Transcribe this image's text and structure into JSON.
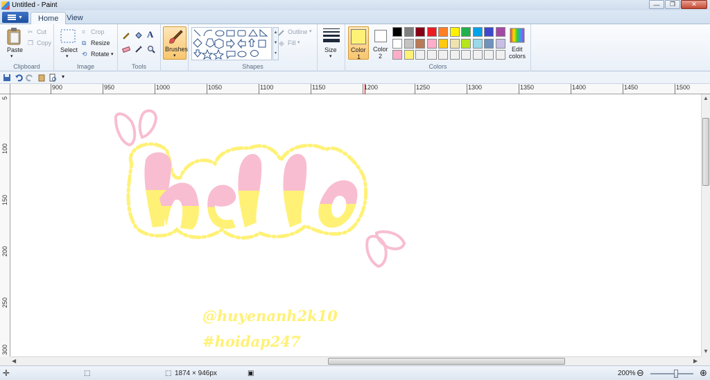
{
  "window": {
    "title": "Untitled - Paint",
    "minimize": "—",
    "maximize": "❐",
    "close": "✕"
  },
  "tabs": [
    {
      "label": "Home"
    },
    {
      "label": "View"
    }
  ],
  "ribbon": {
    "clipboard": {
      "paste": "Paste",
      "cut": "Cut",
      "copy": "Copy",
      "group": "Clipboard"
    },
    "image": {
      "select": "Select",
      "crop": "Crop",
      "resize": "Resize",
      "rotate": "Rotate",
      "group": "Image"
    },
    "tools": {
      "group": "Tools"
    },
    "brushes": {
      "label": "Brushes"
    },
    "shapes": {
      "outline": "Outline",
      "fill": "Fill",
      "group": "Shapes"
    },
    "size": {
      "label": "Size"
    },
    "colors": {
      "color1_label": "Color",
      "color1_num": "1",
      "color2_label": "Color",
      "color2_num": "2",
      "edit_label1": "Edit",
      "edit_label2": "colors",
      "group": "Colors",
      "color1_value": "#fff176",
      "color2_value": "#ffffff",
      "palette_row1": [
        "#000000",
        "#7f7f7f",
        "#880015",
        "#ed1c24",
        "#ff7f27",
        "#fff200",
        "#22b14c",
        "#00a2e8",
        "#3f48cc",
        "#a349a4"
      ],
      "palette_row2": [
        "#ffffff",
        "#c3c3c3",
        "#b97a57",
        "#ffaec9",
        "#ffc90e",
        "#efe4b0",
        "#b5e61d",
        "#99d9ea",
        "#7092be",
        "#c8bfe7"
      ],
      "palette_row3": [
        "#ffaec9",
        "#fff176",
        "#f0f0f0",
        "#f0f0f0",
        "#f0f0f0",
        "#f0f0f0",
        "#f0f0f0",
        "#f0f0f0",
        "#f0f0f0",
        "#f0f0f0"
      ]
    }
  },
  "ruler": {
    "top": [
      "900",
      "950",
      "1000",
      "1050",
      "1100",
      "1150",
      "1200",
      "1250",
      "1300",
      "1350",
      "1400",
      "1450",
      "1500"
    ],
    "left": [
      "5",
      "100",
      "150",
      "200",
      "250",
      "300"
    ]
  },
  "canvas": {
    "word": "hello",
    "pink": "#f8bdd0",
    "yellow": "#fff176",
    "signature1": "@huyenanh2k10",
    "signature2": "#hoidap247"
  },
  "status": {
    "dimensions": "1874 × 946px",
    "zoom": "200%"
  }
}
